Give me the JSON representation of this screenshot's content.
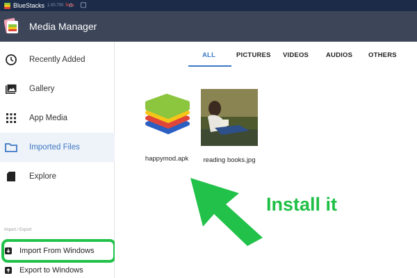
{
  "titlebar": {
    "app_name": "BlueStacks",
    "version": "1.00.700",
    "badge": "Beta"
  },
  "appbar": {
    "title": "Media Manager",
    "icon": "media-manager-icon"
  },
  "sidebar": {
    "items": [
      {
        "label": "Recently Added",
        "icon": "clock-icon",
        "active": false
      },
      {
        "label": "Gallery",
        "icon": "gallery-icon",
        "active": false
      },
      {
        "label": "App Media",
        "icon": "grid-icon",
        "active": false
      },
      {
        "label": "Imported Files",
        "icon": "folder-icon",
        "active": true
      },
      {
        "label": "Explore",
        "icon": "sd-card-icon",
        "active": false
      }
    ],
    "section_label": "Import / Export",
    "import_items": [
      {
        "label": "Import From Windows",
        "icon": "import-icon",
        "highlighted": true
      },
      {
        "label": "Export to Windows",
        "icon": "export-icon",
        "highlighted": false
      }
    ]
  },
  "tabs": [
    {
      "label": "ALL",
      "active": true
    },
    {
      "label": "PICTURES",
      "active": false
    },
    {
      "label": "VIDEOS",
      "active": false
    },
    {
      "label": "AUDIOS",
      "active": false
    },
    {
      "label": "OTHERS",
      "active": false
    }
  ],
  "files": [
    {
      "name": "happymod.apk",
      "thumbnail": "bluestacks-logo"
    },
    {
      "name": "reading books.jpg",
      "thumbnail": "photo-person-reading"
    }
  ],
  "annotation": {
    "text": "Install it",
    "color": "#1fbf45"
  },
  "colors": {
    "accent": "#3b78c4",
    "appbar": "#3d4659",
    "titlebar": "#1c2c48",
    "highlight": "#22c24a"
  }
}
